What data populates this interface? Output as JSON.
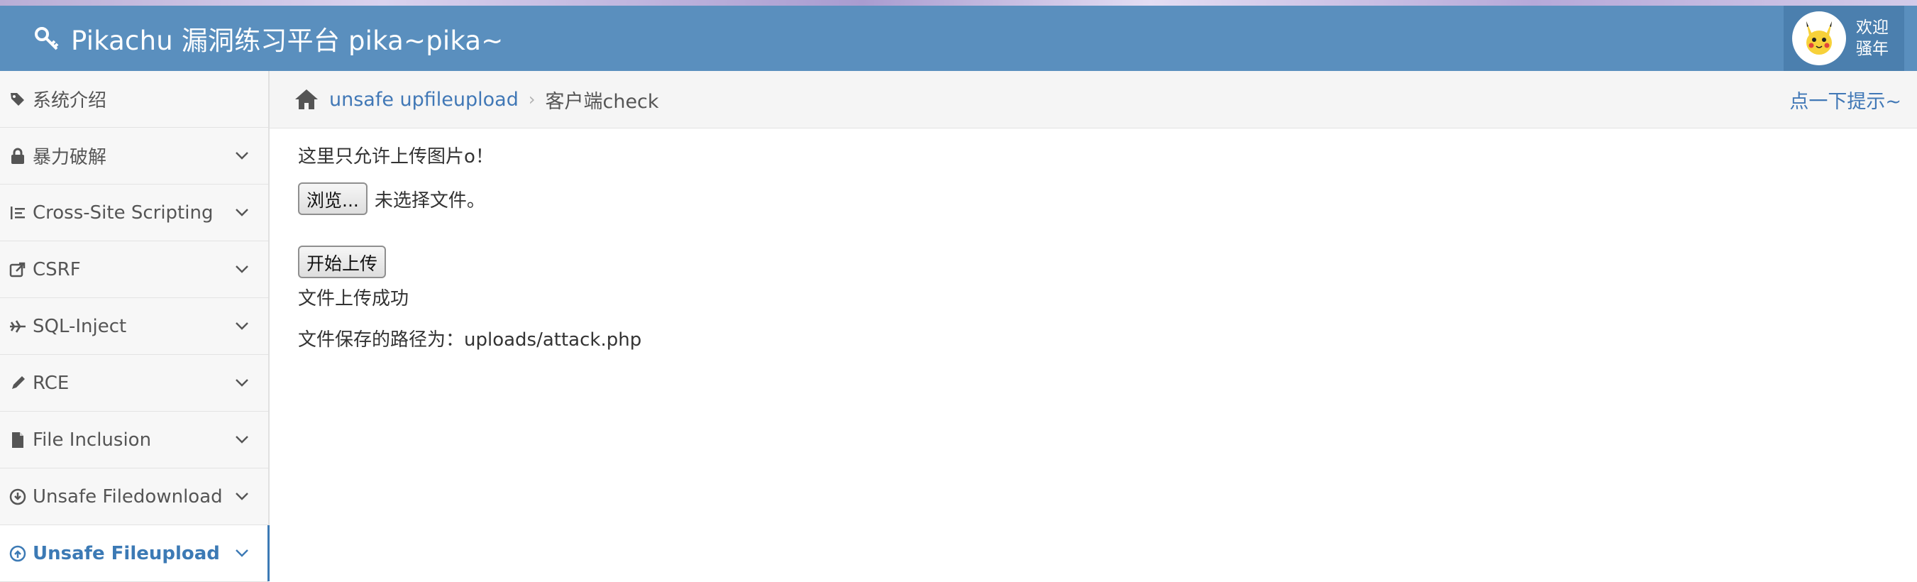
{
  "header": {
    "brand": "Pikachu 漏洞练习平台 pika~pika~",
    "welcome_line1": "欢迎",
    "welcome_line2": "骚年"
  },
  "sidebar": {
    "items": [
      {
        "label": "系统介绍",
        "icon": "tags-icon"
      },
      {
        "label": "暴力破解",
        "icon": "lock-icon"
      },
      {
        "label": "Cross-Site Scripting",
        "icon": "list-indent-icon"
      },
      {
        "label": "CSRF",
        "icon": "share-square-icon"
      },
      {
        "label": "SQL-Inject",
        "icon": "plane-icon"
      },
      {
        "label": "RCE",
        "icon": "pencil-icon"
      },
      {
        "label": "File Inclusion",
        "icon": "file-icon"
      },
      {
        "label": "Unsafe Filedownload",
        "icon": "download-circle-icon"
      },
      {
        "label": "Unsafe Fileupload",
        "icon": "upload-circle-icon"
      }
    ]
  },
  "breadcrumb": {
    "link": "unsafe upfileupload",
    "separator": "›",
    "current": "客户端check",
    "hint": "点一下提示~"
  },
  "main": {
    "notice": "这里只允许上传图片o！",
    "browse_label": "浏览...",
    "no_file_text": "未选择文件。",
    "upload_label": "开始上传",
    "status": "文件上传成功",
    "saved_path": "文件保存的路径为：uploads/attack.php"
  },
  "colors": {
    "navbar": "#5a8fbe",
    "link": "#4178b6",
    "active": "#3c7ab5"
  }
}
